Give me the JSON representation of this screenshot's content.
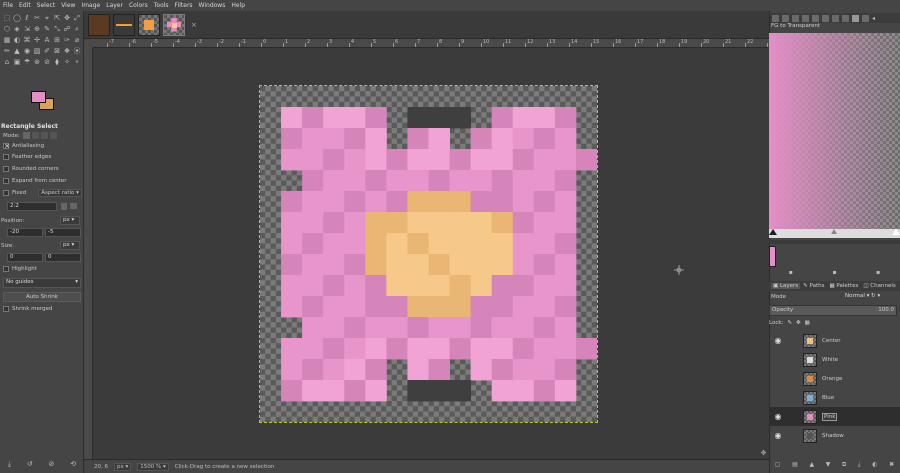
{
  "menu": [
    "File",
    "Edit",
    "Select",
    "View",
    "Image",
    "Layer",
    "Colors",
    "Tools",
    "Filters",
    "Windows",
    "Help"
  ],
  "image_tabs": [
    {
      "name": "brown-thumb",
      "color": "#5a3a20"
    },
    {
      "name": "orange-line-thumb",
      "color": "#f0a040"
    },
    {
      "name": "orange-square-thumb",
      "color": "#f0a040"
    },
    {
      "name": "flower-thumb",
      "color": "#e88ac0"
    }
  ],
  "tab_close": "×",
  "tools": [
    "⬚",
    "◯",
    "ℓ",
    "✂",
    "⌖",
    "⇱",
    "✥",
    "⤢",
    "⬡",
    "◈",
    "⇲",
    "⊕",
    "✎",
    "⤡",
    "☍",
    "⌕",
    "▦",
    "◐",
    "⌘",
    "✢",
    "A",
    "⊞",
    "✑",
    "⌀",
    "✏",
    "▲",
    "◉",
    "▧",
    "✐",
    "⊠",
    "❖",
    "⦿",
    "⌂",
    "▣",
    "☂",
    "⊛",
    "⊘",
    "⧫",
    "✧",
    "⚬"
  ],
  "fg_color": "#e38fc6",
  "bg_color": "#d8a35a",
  "tool_options": {
    "title": "Rectangle Select",
    "mode_label": "Mode:",
    "antialiasing": "Antialiasing",
    "feather": "Feather edges",
    "rounded": "Rounded corners",
    "expand": "Expand from center",
    "fixed": "Fixed",
    "aspect": "Aspect ratio",
    "ratio_value": "2:2",
    "position_label": "Position:",
    "position_unit": "px",
    "pos_x": "-20",
    "pos_y": "-5",
    "size_label": "Size:",
    "size_unit": "px",
    "size_w": "0",
    "size_h": "0",
    "highlight": "Highlight",
    "guides": "No guides",
    "auto_shrink": "Auto Shrink",
    "shrink_merged": "Shrink merged"
  },
  "ruler_ticks": [
    "-7",
    "-6",
    "-5",
    "-4",
    "-3",
    "-2",
    "-1",
    "0",
    "1",
    "2",
    "3",
    "4",
    "5",
    "6",
    "7",
    "8",
    "9",
    "10",
    "11",
    "12",
    "13",
    "14",
    "15",
    "16",
    "17",
    "18",
    "19",
    "20",
    "21",
    "22",
    "23"
  ],
  "status": {
    "coords": "20, 6",
    "unit": "px",
    "zoom": "1500 %",
    "message": "Click-Drag to create a new selection"
  },
  "gradient_title": "FG to Transparent",
  "layers_panel": {
    "tabs": [
      "Layers",
      "Paths",
      "Palettes",
      "Channels"
    ],
    "mode_label": "Mode",
    "mode_value": "Normal",
    "opacity_label": "Opacity",
    "opacity_value": "100.0",
    "lock_label": "Lock:",
    "layers": [
      {
        "name": "Center",
        "visible": true,
        "thumb": "#f2c07a"
      },
      {
        "name": "White",
        "visible": false,
        "thumb": "#dddddd"
      },
      {
        "name": "Orange",
        "visible": false,
        "thumb": "#e08a3a"
      },
      {
        "name": "Blue",
        "visible": false,
        "thumb": "#7ab0e0"
      },
      {
        "name": "Pink",
        "visible": true,
        "thumb": "#e88ac0",
        "selected": true
      },
      {
        "name": "Shadow",
        "visible": true,
        "thumb": "#555555"
      }
    ]
  },
  "art_colors": {
    "pink": "#e795cb",
    "pink_light": "#f0a3d4",
    "pink_dark": "#d685bb",
    "center": "#f6c889",
    "center_edge": "#e9b674",
    "shadow": "#3f3f3f"
  }
}
